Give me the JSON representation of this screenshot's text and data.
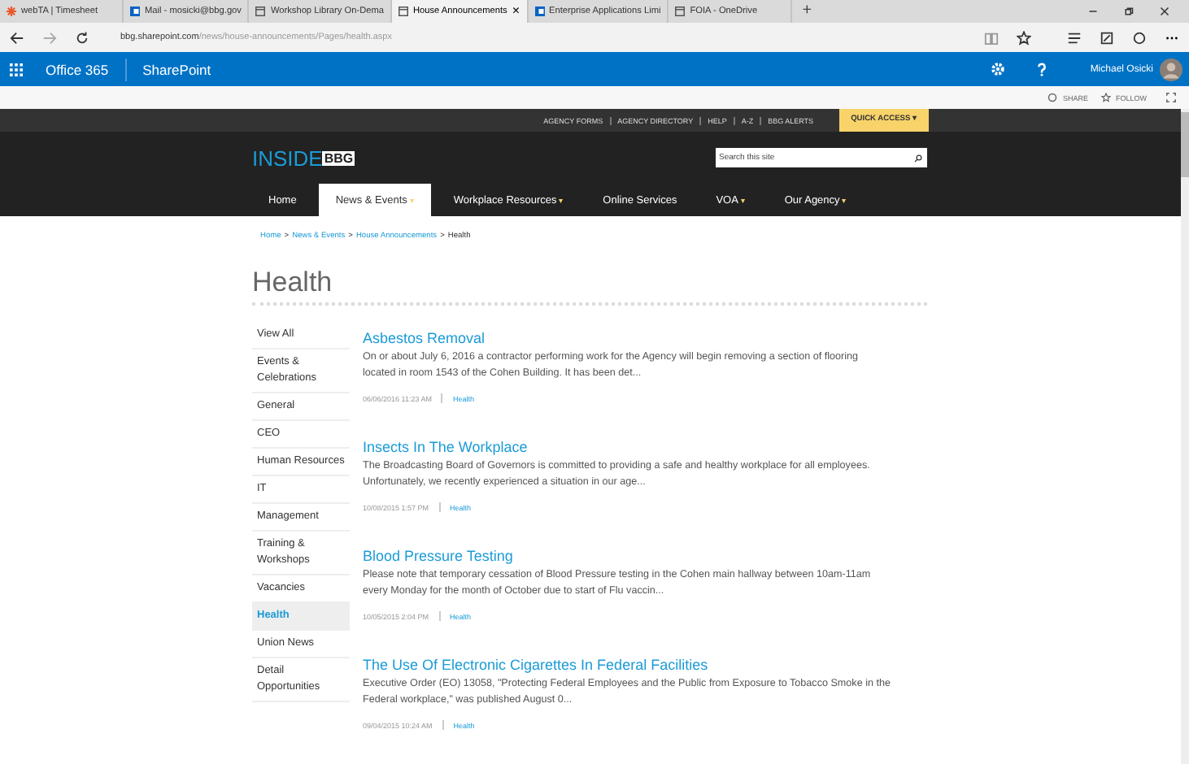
{
  "browser": {
    "tabs": [
      {
        "label": "webTA | Timesheet",
        "selected": false,
        "kind": "star"
      },
      {
        "label": "Mail - mosicki@bbg.gov",
        "selected": false,
        "kind": "mail"
      },
      {
        "label": "Workshop Library On-Dema",
        "selected": false,
        "kind": "page"
      },
      {
        "label": "House Announcements",
        "selected": true,
        "kind": "page"
      },
      {
        "label": "Enterprise Applications Limi",
        "selected": false,
        "kind": "mail"
      },
      {
        "label": "FOIA - OneDrive",
        "selected": false,
        "kind": "page"
      }
    ],
    "close_tab": "×",
    "new_tab": "+",
    "address": {
      "host": "bbg.sharepoint.com",
      "path": "/news/house-announcements/Pages/health.aspx"
    }
  },
  "suite_bar": {
    "app_launcher": "Office 365",
    "site": "SharePoint",
    "user": "Michael Osicki"
  },
  "page_actions": [
    "SHARE",
    "FOLLOW"
  ],
  "utility_links": [
    "AGENCY FORMS",
    "AGENCY DIRECTORY",
    "HELP",
    "A-Z",
    "BBG ALERTS"
  ],
  "quick_access": "QUICK ACCESS ▾",
  "logo": {
    "part_1": "INSIDE",
    "part_2": "BBG"
  },
  "search": {
    "placeholder": "Search this site"
  },
  "nav": [
    {
      "label": "Home",
      "selected": false,
      "dropdown": false
    },
    {
      "label": "News & Events",
      "selected": true,
      "dropdown": true
    },
    {
      "label": "Workplace Resources",
      "selected": false,
      "dropdown": true
    },
    {
      "label": "Online Services",
      "selected": false,
      "dropdown": false
    },
    {
      "label": "VOA",
      "selected": false,
      "dropdown": true
    },
    {
      "label": "Our Agency",
      "selected": false,
      "dropdown": true
    }
  ],
  "dropdown_mark": "▾",
  "breadcrumb": {
    "links": [
      "Home",
      "News & Events",
      "House Announcements"
    ],
    "separator": ">",
    "current": "Health"
  },
  "page_title": "Health",
  "sidebar": [
    {
      "label": "View All",
      "selected": false
    },
    {
      "label": "Events & Celebrations",
      "selected": false
    },
    {
      "label": "General",
      "selected": false
    },
    {
      "label": "CEO",
      "selected": false
    },
    {
      "label": "Human Resources",
      "selected": false
    },
    {
      "label": "IT",
      "selected": false
    },
    {
      "label": "Management",
      "selected": false
    },
    {
      "label": "Training & Workshops",
      "selected": false
    },
    {
      "label": "Vacancies",
      "selected": false
    },
    {
      "label": "Health",
      "selected": true
    },
    {
      "label": "Union News",
      "selected": false
    },
    {
      "label": "Detail Opportunities",
      "selected": false
    }
  ],
  "articles": [
    {
      "title": "Asbestos Removal",
      "summary": "On or about July 6, 2016 a contractor performing work for the Agency will begin removing a section of flooring located in room 1543 of the Cohen Building. It has been det...",
      "date": "06/06/2016 11:23 AM",
      "tag": "Health"
    },
    {
      "title": "Insects In The Workplace",
      "summary": "The Broadcasting Board of Governors is committed to providing a safe and healthy workplace for all employees. Unfortunately, we recently experienced a situation in our age...",
      "date": "10/08/2015 1:57 PM",
      "tag": "Health"
    },
    {
      "title": "Blood Pressure Testing",
      "summary": "Please note that temporary cessation of Blood Pressure testing in the Cohen main hallway between 10am-11am every Monday for the month of October due to start of Flu vaccin...",
      "date": "10/05/2015 2:04 PM",
      "tag": "Health"
    },
    {
      "title": "The Use Of Electronic Cigarettes In Federal Facilities",
      "summary": "Executive Order (EO) 13058, \"Protecting Federal Employees and the Public from Exposure to Tobacco Smoke in the Federal workplace,\" was published August 0...",
      "date": "09/04/2015 10:24 AM",
      "tag": "Health"
    }
  ]
}
